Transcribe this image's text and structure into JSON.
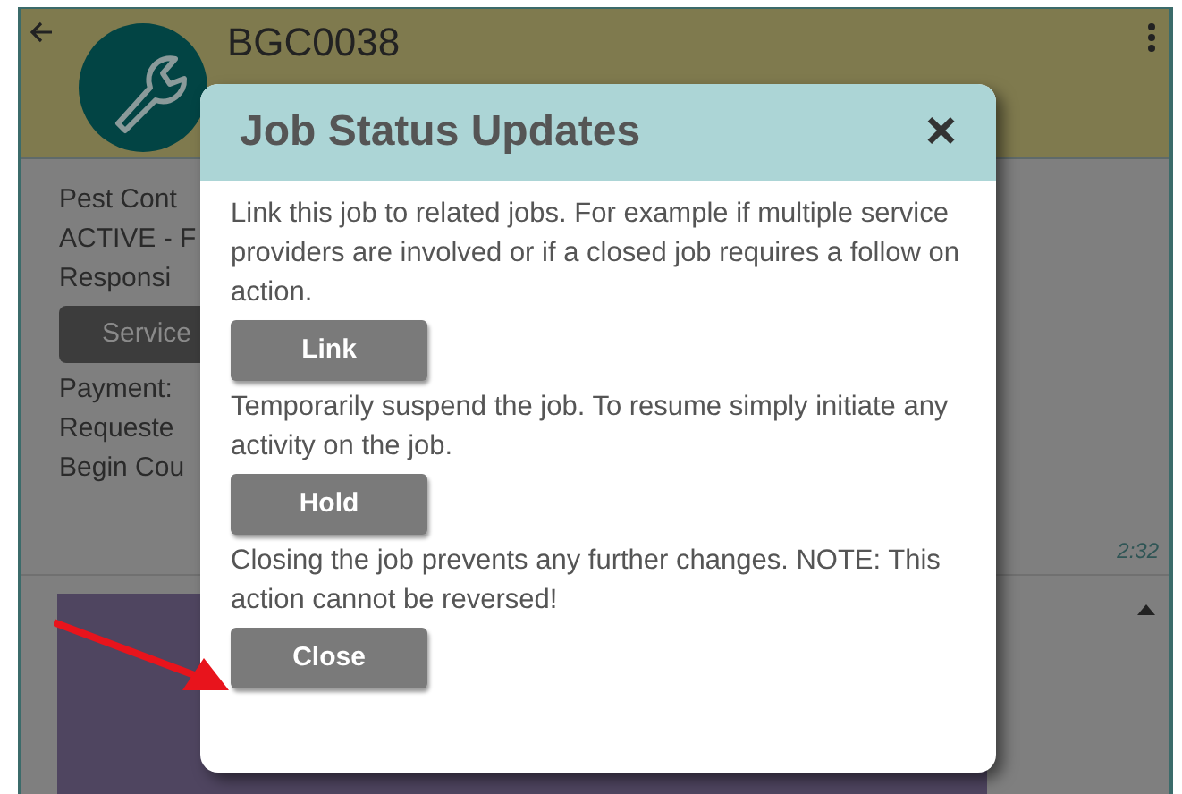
{
  "header": {
    "title": "BGC0038"
  },
  "details": [
    "Pest Cont",
    "ACTIVE - F",
    "Responsi"
  ],
  "service_button": "Service",
  "details_2": [
    "Payment:",
    "Requeste",
    "Begin Cou"
  ],
  "timestamp": "2:32",
  "dialog": {
    "title": "Job Status Updates",
    "close": "×",
    "actions": [
      {
        "description": "Link this job to related jobs. For example if multiple service providers are involved or if a closed job requires a follow on action.",
        "button": "Link"
      },
      {
        "description": "Temporarily suspend the job. To resume simply initiate any activity on the job.",
        "button": "Hold"
      },
      {
        "description": "Closing the job prevents any further changes. NOTE: This action cannot be reversed!",
        "button": "Close"
      }
    ]
  }
}
